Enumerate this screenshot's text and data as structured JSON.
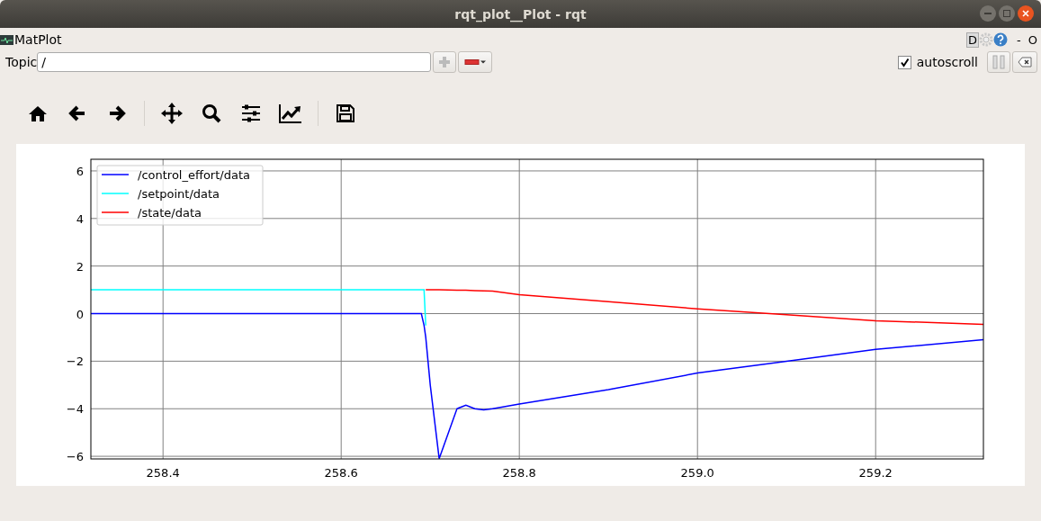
{
  "window": {
    "title": "rqt_plot__Plot - rqt"
  },
  "plugin": {
    "title": "MatPlot",
    "d_label": "D",
    "minus_label": "-",
    "close_label": "O"
  },
  "topic": {
    "label": "Topic",
    "value": "/"
  },
  "autoscroll": {
    "label": "autoscroll",
    "checked": true
  },
  "plot": {
    "chart_data": {
      "type": "line",
      "grid": true,
      "legend": true,
      "x": [
        258.319,
        258.69,
        258.693,
        258.695,
        258.7,
        258.71,
        258.73,
        258.74,
        258.75,
        258.76,
        258.77,
        258.8,
        258.9,
        259.0,
        259.1,
        259.2,
        259.321
      ],
      "series": [
        {
          "name": "/control_effort/data",
          "color": "#0000ff",
          "values": [
            0,
            0,
            -0.5,
            -1,
            -3,
            -6.1,
            -4,
            -3.85,
            -4,
            -4.05,
            -4,
            -3.8,
            -3.2,
            -2.5,
            -2.0,
            -1.5,
            -1.1
          ]
        },
        {
          "name": "/setpoint/data",
          "color": "#00ffff",
          "values": [
            1,
            1,
            1,
            -0.5,
            null,
            null,
            null,
            null,
            null,
            null,
            null,
            null,
            null,
            null,
            null,
            null,
            null
          ]
        },
        {
          "name": "/state/data",
          "color": "#ff0000",
          "values": [
            null,
            null,
            null,
            1.0,
            1.0,
            1.0,
            0.99,
            0.98,
            0.97,
            0.96,
            0.95,
            0.8,
            0.5,
            0.2,
            -0.05,
            -0.3,
            -0.45
          ]
        }
      ],
      "xlim": [
        258.319,
        259.321
      ],
      "ylim": [
        -6.11,
        6.49
      ],
      "xticks": [
        {
          "value": 258.4,
          "label": "258.4"
        },
        {
          "value": 258.6,
          "label": "258.6"
        },
        {
          "value": 258.8,
          "label": "258.8"
        },
        {
          "value": 259.0,
          "label": "259.0"
        },
        {
          "value": 259.2,
          "label": "259.2"
        }
      ],
      "yticks": [
        {
          "value": -6,
          "label": "−6"
        },
        {
          "value": -4,
          "label": "−4"
        },
        {
          "value": -2,
          "label": "−2"
        },
        {
          "value": 0,
          "label": "0"
        },
        {
          "value": 2,
          "label": "2"
        },
        {
          "value": 4,
          "label": "4"
        },
        {
          "value": 6,
          "label": "6"
        }
      ]
    }
  }
}
